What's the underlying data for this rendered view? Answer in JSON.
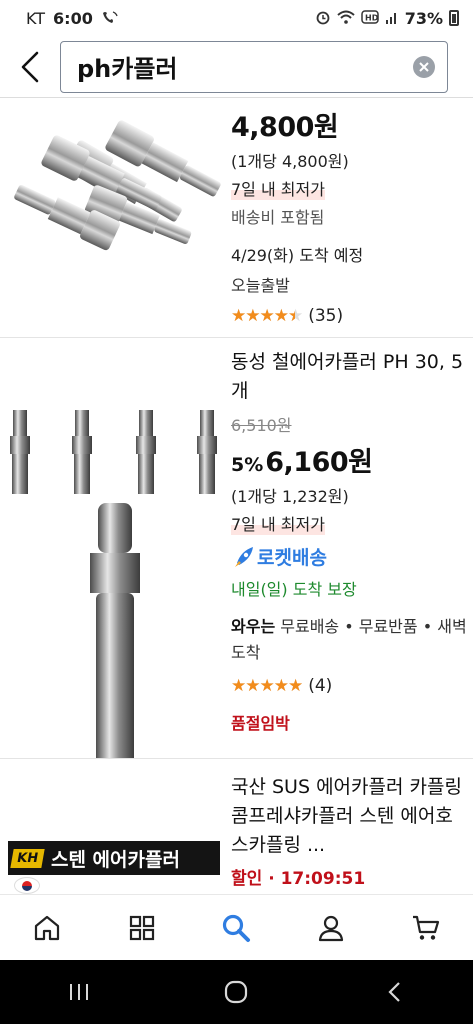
{
  "status": {
    "carrier": "KT",
    "time": "6:00",
    "battery": "73%"
  },
  "search": {
    "query": "ph카플러"
  },
  "products": [
    {
      "price": "4,800원",
      "unit_price": "(1개당 4,800원)",
      "lowest_price": "7일 내 최저가",
      "shipping": "배송비 포함됨",
      "arrival": "4/29(화) 도착 예정",
      "departure": "오늘출발",
      "rating": 4.5,
      "review_count": "(35)"
    },
    {
      "title": "동성 철에어카플러 PH 30, 5개",
      "original_price": "6,510원",
      "discount": "5%",
      "price": "6,160원",
      "unit_price": "(1개당 1,232원)",
      "lowest_price": "7일 내 최저가",
      "rocket_label": "로켓배송",
      "guarantee": "내일(일) 도착 보장",
      "wow_label": "와우는",
      "wow_text": " 무료배송 • 무료반품 • 새벽도착",
      "rating": 5,
      "review_count": "(4)",
      "stock_status": "품절임박"
    },
    {
      "title": "국산 SUS 에어카플러 카플링 콤프레샤카플러 스텐 에어호스카플링 ...",
      "sale_text": "할인 · 17:09:51",
      "banner_text": "스텐 에어카플러",
      "logo_text": "KH"
    }
  ],
  "colors": {
    "accent_blue": "#2f7de1",
    "sale_red": "#c0101a",
    "star": "#f28c1c"
  }
}
